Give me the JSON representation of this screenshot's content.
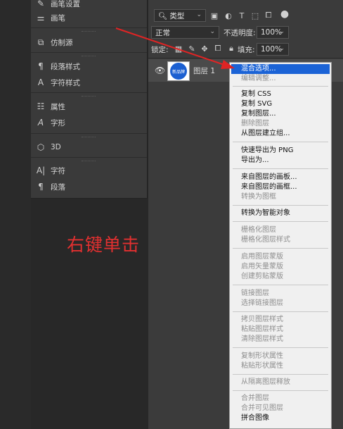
{
  "left_panels": {
    "items": [
      {
        "label": "画笔设置",
        "icon": "brush-settings-icon",
        "glyph": "✎"
      },
      {
        "label": "画笔",
        "icon": "brush-icon",
        "glyph": "⚌"
      },
      {
        "label": "仿制源",
        "icon": "clone-source-icon",
        "glyph": "⧉"
      },
      {
        "label": "段落样式",
        "icon": "paragraph-styles-icon",
        "glyph": "¶"
      },
      {
        "label": "字符样式",
        "icon": "character-styles-icon",
        "glyph": "A"
      },
      {
        "label": "属性",
        "icon": "properties-icon",
        "glyph": "☷"
      },
      {
        "label": "字形",
        "icon": "glyphs-icon",
        "glyph": "𝒜"
      },
      {
        "label": "3D",
        "icon": "3d-cube-icon",
        "glyph": "⬡"
      },
      {
        "label": "字符",
        "icon": "character-icon",
        "glyph": "A"
      },
      {
        "label": "段落",
        "icon": "paragraph-icon",
        "glyph": "¶"
      }
    ]
  },
  "layers_panel": {
    "filter_kind": "类型",
    "blend_mode": "正常",
    "opacity_label": "不透明度:",
    "opacity_value": "100%",
    "lock_label": "锁定:",
    "fill_label": "填充:",
    "fill_value": "100%",
    "layer_name": "图层 1",
    "thumbnail_text": "新品牌"
  },
  "context_menu": {
    "items": [
      "混合选项...",
      "编辑调整...",
      "复制 CSS",
      "复制 SVG",
      "复制图层...",
      "删除图层",
      "从图层建立组...",
      "快速导出为 PNG",
      "导出为...",
      "来自图层的画板...",
      "来自图层的画框...",
      "转换为图框",
      "转换为智能对象",
      "栅格化图层",
      "栅格化图层样式",
      "启用图层蒙版",
      "启用矢量蒙版",
      "创建剪贴蒙版",
      "链接图层",
      "选择链接图层",
      "拷贝图层样式",
      "粘贴图层样式",
      "清除图层样式",
      "复制形状属性",
      "粘贴形状属性",
      "从隔离图层释放",
      "合并图层",
      "合并可见图层",
      "拼合图像"
    ]
  },
  "annotation": {
    "text": "右键单击",
    "color": "#e33030"
  },
  "colors": {
    "highlight": "#1b63d6",
    "panel_bg": "#3b3b3b",
    "menu_bg": "#f0f0f0"
  }
}
